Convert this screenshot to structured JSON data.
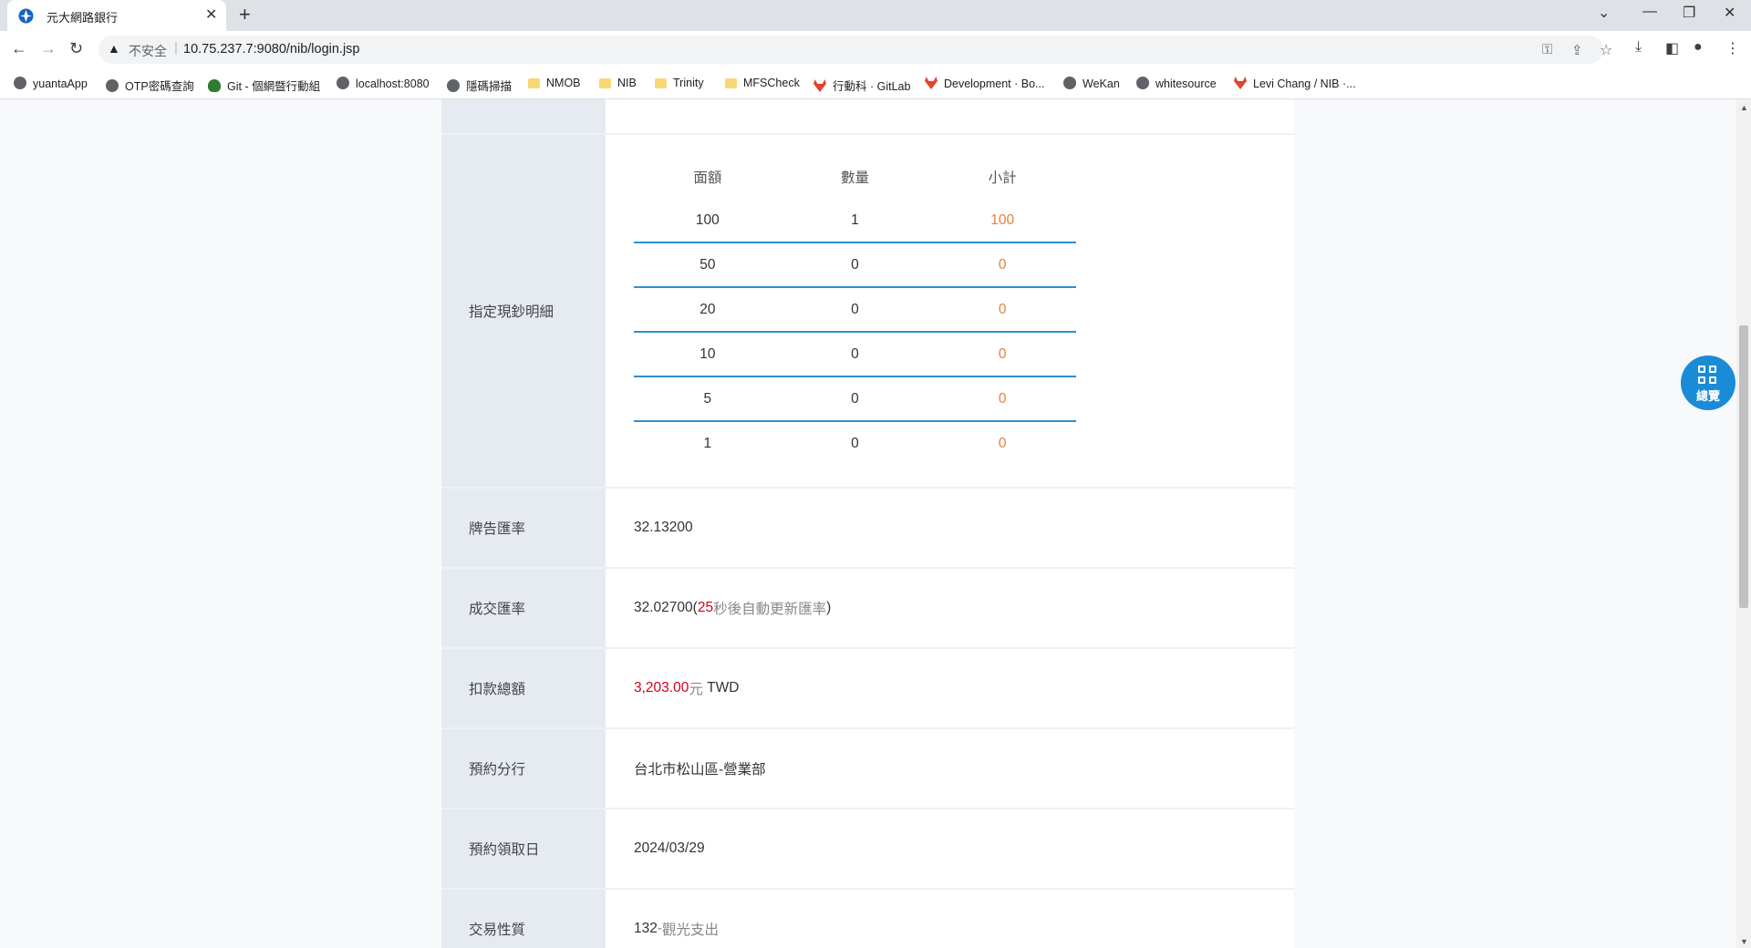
{
  "browser": {
    "tab_title": "元大網路銀行",
    "insecure_label": "不安全",
    "url": "10.75.237.7:9080/nib/login.jsp",
    "bookmarks": [
      {
        "label": "yuantaApp",
        "icon": "globe"
      },
      {
        "label": "OTP密碼查詢",
        "icon": "globe"
      },
      {
        "label": "Git - 個網暨行動組",
        "icon": "git"
      },
      {
        "label": "localhost:8080",
        "icon": "globe"
      },
      {
        "label": "隱碼掃描",
        "icon": "globe"
      },
      {
        "label": "NMOB",
        "icon": "folder"
      },
      {
        "label": "NIB",
        "icon": "folder"
      },
      {
        "label": "Trinity",
        "icon": "folder"
      },
      {
        "label": "MFSCheck",
        "icon": "folder"
      },
      {
        "label": "行動科 · GitLab",
        "icon": "gitlab"
      },
      {
        "label": "Development · Bo...",
        "icon": "gitlab"
      },
      {
        "label": "WeKan",
        "icon": "globe"
      },
      {
        "label": "whitesource",
        "icon": "globe"
      },
      {
        "label": "Levi Chang / NIB ·...",
        "icon": "gitlab"
      }
    ]
  },
  "form": {
    "cash_detail": {
      "label": "指定現鈔明細",
      "headers": [
        "面額",
        "數量",
        "小計"
      ],
      "rows": [
        {
          "denom": "100",
          "qty": "1",
          "subtotal": "100"
        },
        {
          "denom": "50",
          "qty": "0",
          "subtotal": "0"
        },
        {
          "denom": "20",
          "qty": "0",
          "subtotal": "0"
        },
        {
          "denom": "10",
          "qty": "0",
          "subtotal": "0"
        },
        {
          "denom": "5",
          "qty": "0",
          "subtotal": "0"
        },
        {
          "denom": "1",
          "qty": "0",
          "subtotal": "0"
        }
      ]
    },
    "board_rate": {
      "label": "牌告匯率",
      "value": "32.13200"
    },
    "deal_rate": {
      "label": "成交匯率",
      "value": "32.02700",
      "paren_open": "(",
      "seconds": "25",
      "suffix": "秒後自動更新匯率",
      "paren_close": ")"
    },
    "debit_total": {
      "label": "扣款總額",
      "amount": "3,203.00",
      "unit": "元",
      "currency": "TWD"
    },
    "branch": {
      "label": "預約分行",
      "value": "台北市松山區-營業部"
    },
    "pickup_date": {
      "label": "預約領取日",
      "value": "2024/03/29"
    },
    "purpose": {
      "label": "交易性質",
      "code": "132",
      "dash": " - ",
      "desc": "觀光支出"
    }
  },
  "overview_button": {
    "label": "總覽"
  },
  "colors": {
    "accent": "#1a8bd6",
    "table_line": "#2d8fd5",
    "subtotal": "#e67e45",
    "emphasis": "#d0021b",
    "label_bg": "#e6ebf2"
  }
}
